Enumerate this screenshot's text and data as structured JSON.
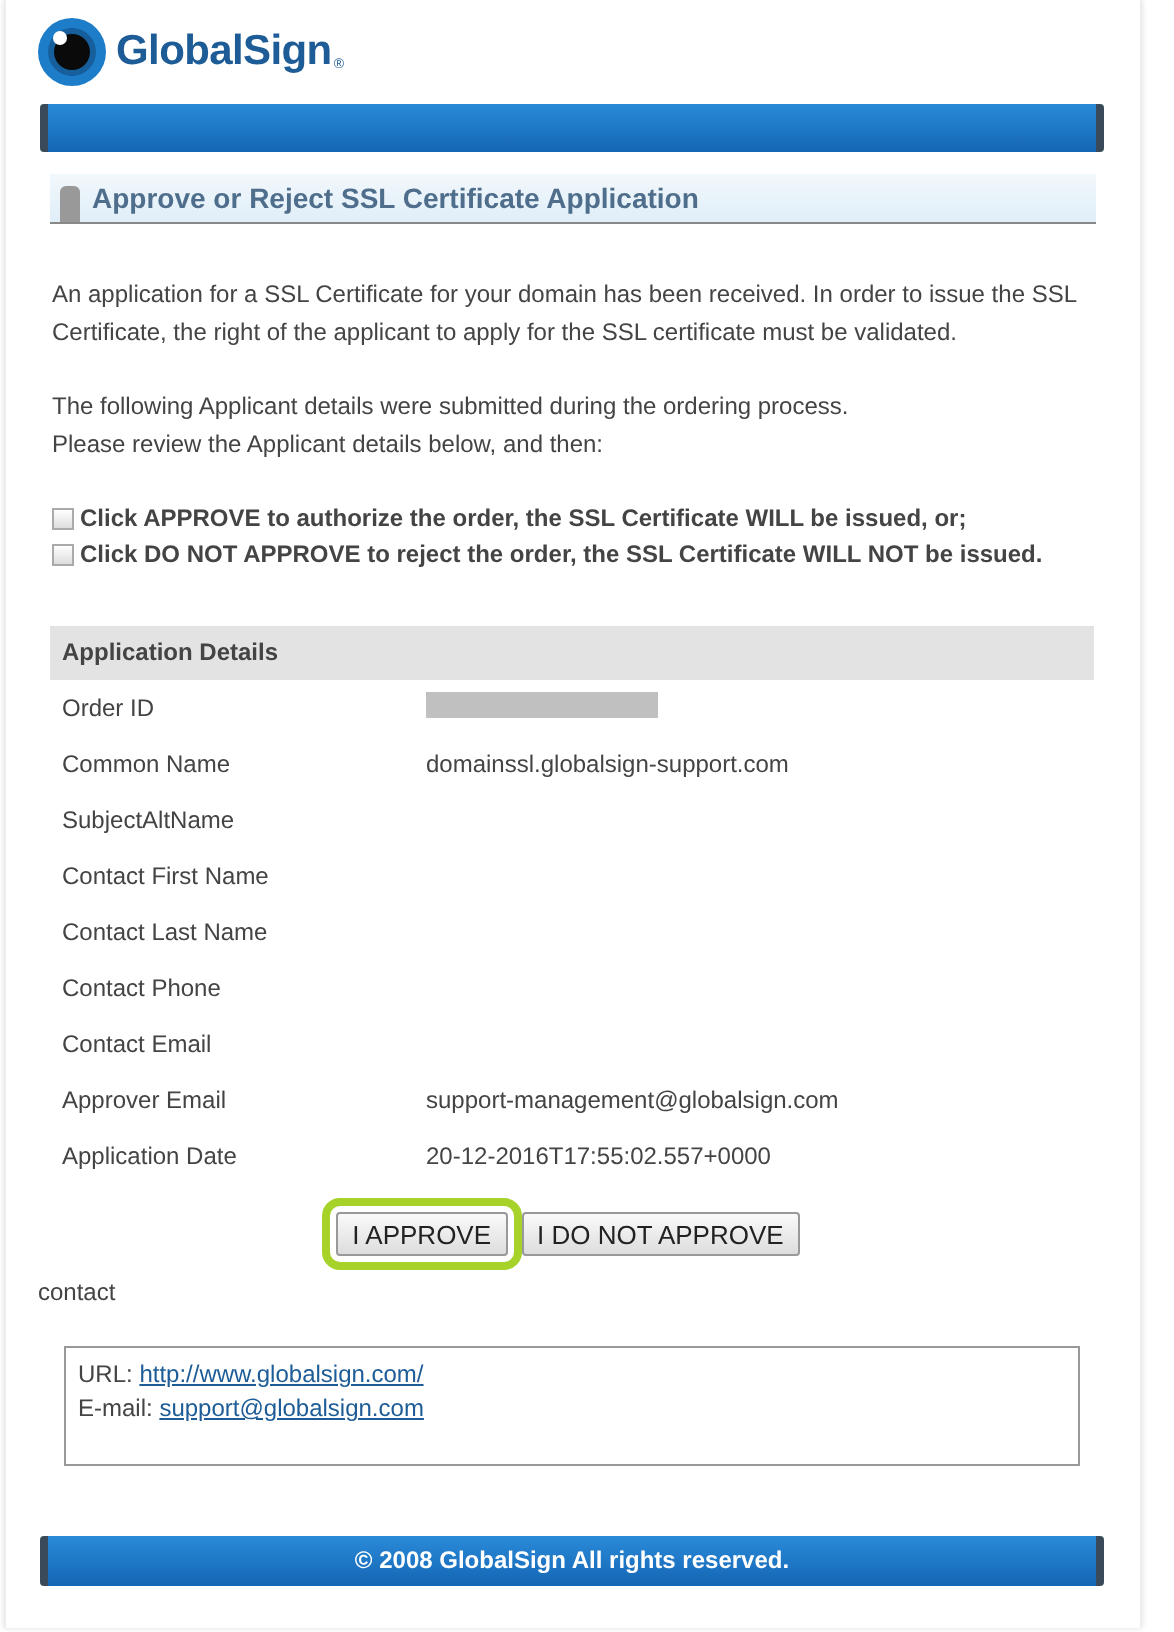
{
  "logo": {
    "name": "GlobalSign",
    "mark": "®"
  },
  "section": {
    "title": "Approve or Reject SSL Certificate Application"
  },
  "intro": [
    [
      "An application for a SSL Certificate for your domain has been received. In order to issue the SSL Certificate, the right of the applicant to apply for the SSL certificate must be validated."
    ],
    [
      "The following Applicant details were submitted during the ordering process.",
      "Please review the Applicant details below, and then:"
    ]
  ],
  "instructions": [
    "Click APPROVE to authorize the order, the SSL Certificate WILL be issued, or;",
    "Click DO NOT APPROVE to reject the order, the SSL Certificate WILL NOT be issued."
  ],
  "details": {
    "title": "Application Details",
    "rows": [
      {
        "label": "Order ID",
        "redacted": true
      },
      {
        "label": "Common Name",
        "value": "domainssl.globalsign-support.com",
        "redacted": false
      },
      {
        "label": "SubjectAltName",
        "redacted": false
      },
      {
        "label": "Contact First Name",
        "redacted": false
      },
      {
        "label": "Contact Last Name",
        "redacted": false
      },
      {
        "label": "Contact Phone",
        "redacted": false
      },
      {
        "label": "Contact Email",
        "redacted": false
      },
      {
        "label": "Approver Email",
        "value": "support-management@globalsign.com",
        "redacted": false
      },
      {
        "label": "Application Date",
        "value": "20-12-2016T17:55:02.557+0000",
        "redacted": false
      }
    ]
  },
  "buttons": [
    {
      "label": "I APPROVE",
      "highlighted": true
    },
    {
      "label": "I DO NOT APPROVE",
      "highlighted": false
    }
  ],
  "contact": {
    "title": "contact",
    "lines": [
      {
        "label": "URL:",
        "link": "http://www.globalsign.com/"
      },
      {
        "label": "E-mail:",
        "link": "support@globalsign.com"
      }
    ]
  },
  "footer": "© 2008 GlobalSign All rights reserved."
}
